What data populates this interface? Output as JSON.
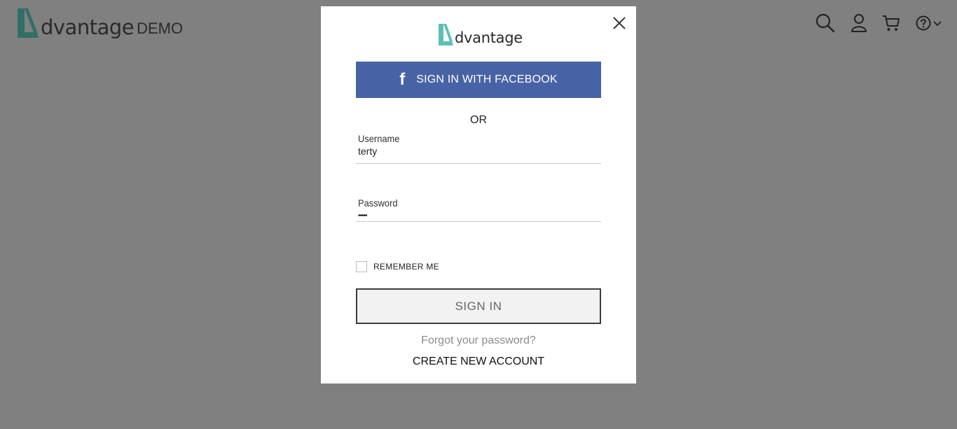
{
  "header": {
    "brand_name": "dvantage",
    "brand_suffix": "DEMO",
    "icons": [
      "search-icon",
      "user-icon",
      "cart-icon",
      "help-icon",
      "chevron-down-icon"
    ]
  },
  "modal": {
    "logo_name": "dvantage",
    "facebook_label": "SIGN IN WITH FACEBOOK",
    "or_text": "OR",
    "username_label": "Username",
    "username_value": "terty",
    "password_label": "Password",
    "password_value": "•••••",
    "remember_label": "REMEMBER ME",
    "remember_checked": false,
    "signin_label": "SIGN IN",
    "forgot_label": "Forgot your password?",
    "create_label": "CREATE NEW ACCOUNT"
  },
  "colors": {
    "overlay": "#808080",
    "accent_teal": "#5cbfb1",
    "facebook_blue": "#4863a5",
    "modal_bg": "#ffffff"
  }
}
